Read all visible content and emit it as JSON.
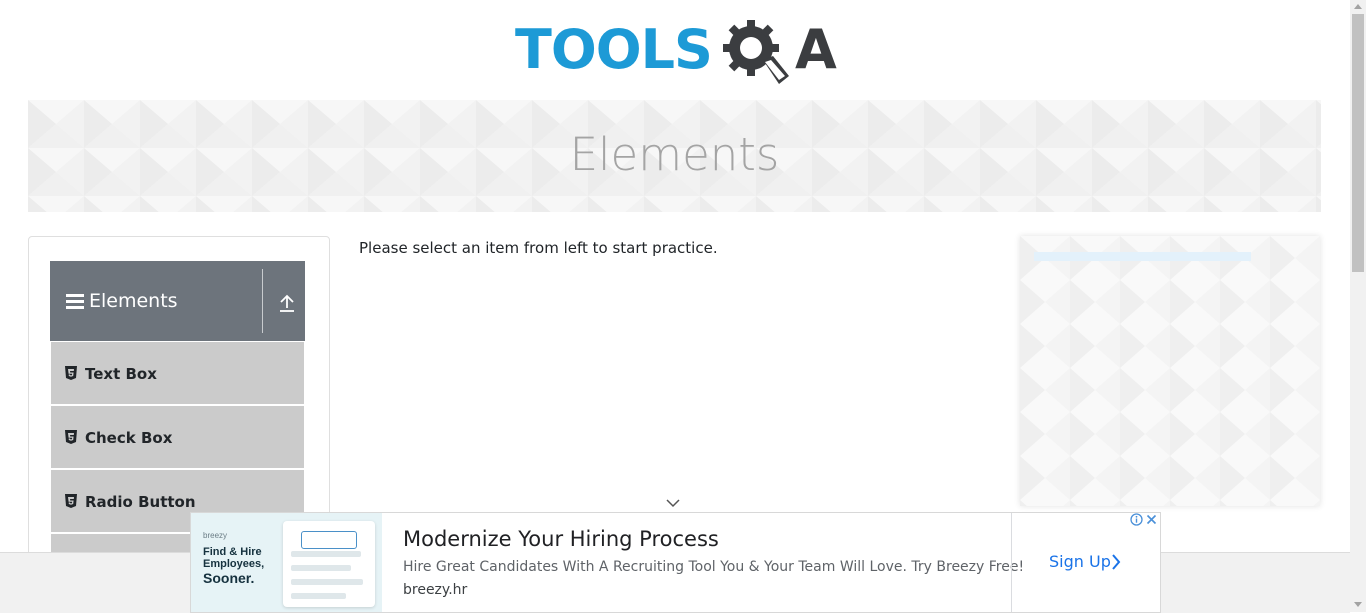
{
  "logo": {
    "tools_text": "TOOLS",
    "qa_letter": "A",
    "colors": {
      "tools": "#1d9ad6",
      "qa": "#3b3d40"
    }
  },
  "banner": {
    "title": "Elements"
  },
  "sidebar": {
    "group": {
      "title": "Elements",
      "icon_left": "hamburger-icon",
      "icon_right": "upload-icon"
    },
    "items": [
      {
        "label": "Text Box",
        "icon": "html5-icon"
      },
      {
        "label": "Check Box",
        "icon": "html5-icon"
      },
      {
        "label": "Radio Button",
        "icon": "html5-icon"
      }
    ]
  },
  "main": {
    "instruction": "Please select an item from left to start practice."
  },
  "ad": {
    "thumbnail": {
      "brand": "breezy",
      "line1": "Find & Hire",
      "line2": "Employees,",
      "line3": "Sooner."
    },
    "title": "Modernize Your Hiring Process",
    "description": "Hire Great Candidates With A Recruiting Tool You & Your Team Will Love. Try Breezy Free!",
    "domain": "breezy.hr",
    "cta": "Sign Up",
    "colors": {
      "cta": "#1a73e8",
      "adchoices": "#4a90d9"
    }
  }
}
